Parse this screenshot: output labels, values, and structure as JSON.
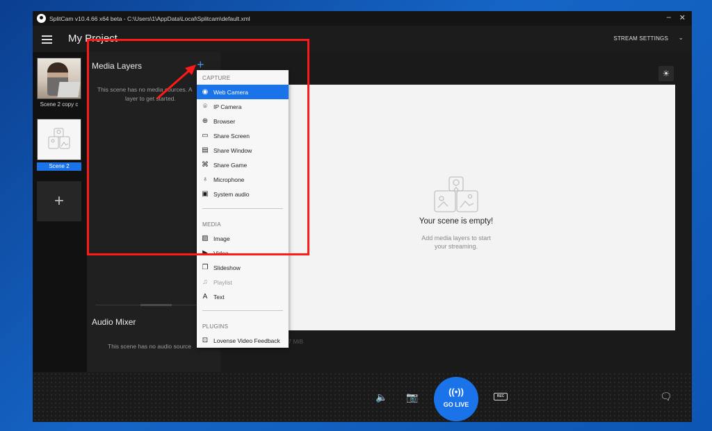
{
  "window": {
    "title": "SplitCam v10.4.66 x64 beta - C:\\Users\\1\\AppData\\Local\\Splitcam\\default.xml",
    "minimize_glyph": "–",
    "close_glyph": "✕"
  },
  "header": {
    "project_title": "My Project",
    "stream_settings_label": "STREAM SETTINGS",
    "chevron_glyph": "⌄"
  },
  "scenes": {
    "items": [
      {
        "label": "Scene 2 copy c",
        "selected": false
      },
      {
        "label": "Scene 2",
        "selected": true
      }
    ],
    "add_glyph": "+"
  },
  "media_layers": {
    "title": "Media Layers",
    "add_glyph": "+",
    "empty_line1": "This scene has no media sources. A",
    "empty_line2": "layer to get started."
  },
  "audio_mixer": {
    "title": "Audio Mixer",
    "empty_text": "This scene has no audio source"
  },
  "preview": {
    "settings_glyph": "☀",
    "empty_title": "Your scene is empty!",
    "empty_sub_line1": "Add media layers to start",
    "empty_sub_line2": "your streaming.",
    "memory_text": "307 MiB"
  },
  "bottom_bar": {
    "volume_glyph": "🔈",
    "snapshot_glyph": "📷",
    "golive_wave": "((•))",
    "golive_label": "GO LIVE",
    "rec_label": "REC",
    "chat_glyph": "🗨"
  },
  "menu": {
    "capture_header": "CAPTURE",
    "media_header": "MEDIA",
    "plugins_header": "PLUGINS",
    "capture_items": [
      {
        "label": "Web Camera",
        "icon": "webcam-icon",
        "glyph": "◉"
      },
      {
        "label": "IP Camera",
        "icon": "ip-camera-icon",
        "glyph": "⌾"
      },
      {
        "label": "Browser",
        "icon": "globe-icon",
        "glyph": "⊕"
      },
      {
        "label": "Share Screen",
        "icon": "screen-icon",
        "glyph": "▭"
      },
      {
        "label": "Share Window",
        "icon": "window-icon",
        "glyph": "▤"
      },
      {
        "label": "Share Game",
        "icon": "gamepad-icon",
        "glyph": "⌘"
      },
      {
        "label": "Microphone",
        "icon": "microphone-icon",
        "glyph": "♁"
      },
      {
        "label": "System audio",
        "icon": "speaker-icon",
        "glyph": "▣"
      }
    ],
    "media_items": [
      {
        "label": "Image",
        "icon": "image-icon",
        "glyph": "▨"
      },
      {
        "label": "Video",
        "icon": "video-icon",
        "glyph": "▶"
      },
      {
        "label": "Slideshow",
        "icon": "slideshow-icon",
        "glyph": "❐"
      },
      {
        "label": "Playlist",
        "icon": "playlist-icon",
        "glyph": "♫"
      },
      {
        "label": "Text",
        "icon": "text-icon",
        "glyph": "A"
      }
    ],
    "plugin_items": [
      {
        "label": "Lovense Video Feedback",
        "icon": "plugin-icon",
        "glyph": "⊡"
      }
    ]
  },
  "colors": {
    "accent": "#1a73e8",
    "annotation": "#ff1a1a"
  }
}
